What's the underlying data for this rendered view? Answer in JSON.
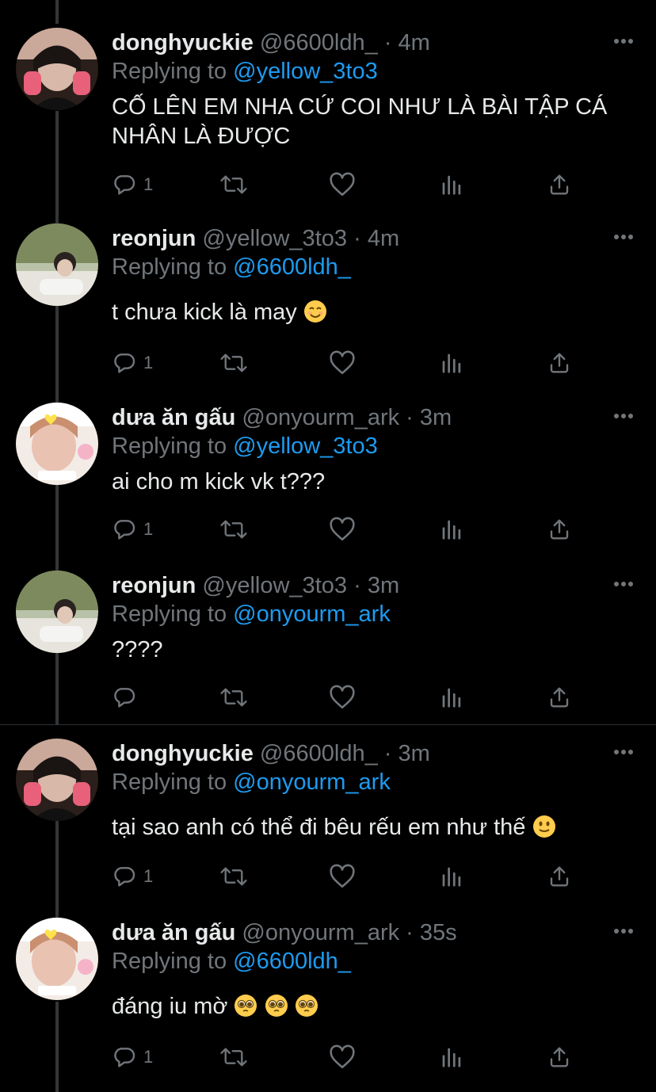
{
  "tweets": [
    {
      "name": "donghyuckie",
      "handle": "@6600ldh_",
      "sep": "·",
      "time": "4m",
      "replying_prefix": "Replying to",
      "replying_to": "@yellow_3to3",
      "text": "CỐ LÊN EM NHA CỨ COI NHƯ LÀ BÀI TẬP CÁ NHÂN LÀ ĐƯỢC",
      "reply_count": "1",
      "avatar": "avatar-dark-hair"
    },
    {
      "name": "reonjun",
      "handle": "@yellow_3to3",
      "sep": "·",
      "time": "4m",
      "replying_prefix": "Replying to",
      "replying_to": "@6600ldh_",
      "text": "t chưa kick là may",
      "emoji": "smiling-face",
      "reply_count": "1",
      "avatar": "avatar-outdoor"
    },
    {
      "name": "dưa ăn gấu",
      "handle": "@onyourm_ark",
      "sep": "·",
      "time": "3m",
      "replying_prefix": "Replying to",
      "replying_to": "@yellow_3to3",
      "text": "ai cho m kick vk t???",
      "reply_count": "1",
      "avatar": "avatar-sticker"
    },
    {
      "name": "reonjun",
      "handle": "@yellow_3to3",
      "sep": "·",
      "time": "3m",
      "replying_prefix": "Replying to",
      "replying_to": "@onyourm_ark",
      "text": "????",
      "reply_count": "",
      "avatar": "avatar-outdoor"
    },
    {
      "name": "donghyuckie",
      "handle": "@6600ldh_",
      "sep": "·",
      "time": "3m",
      "replying_prefix": "Replying to",
      "replying_to": "@onyourm_ark",
      "text": "tại sao anh có thể đi bêu rếu em như thế",
      "emoji": "slightly-smiling-face",
      "reply_count": "1",
      "avatar": "avatar-dark-hair"
    },
    {
      "name": "dưa ăn gấu",
      "handle": "@onyourm_ark",
      "sep": "·",
      "time": "35s",
      "replying_prefix": "Replying to",
      "replying_to": "@6600ldh_",
      "text": "đáng iu mờ",
      "emoji": "pleading-face-x3",
      "reply_count": "1",
      "avatar": "avatar-sticker"
    }
  ],
  "icons": {
    "reply": "reply-icon",
    "retweet": "retweet-icon",
    "like": "heart-icon",
    "analytics": "analytics-icon",
    "share": "share-icon",
    "more": "more-icon"
  },
  "colors": {
    "background": "#000000",
    "text": "#e7e9ea",
    "muted": "#71767b",
    "link": "#1d9bf0",
    "thread_line": "#333639"
  }
}
